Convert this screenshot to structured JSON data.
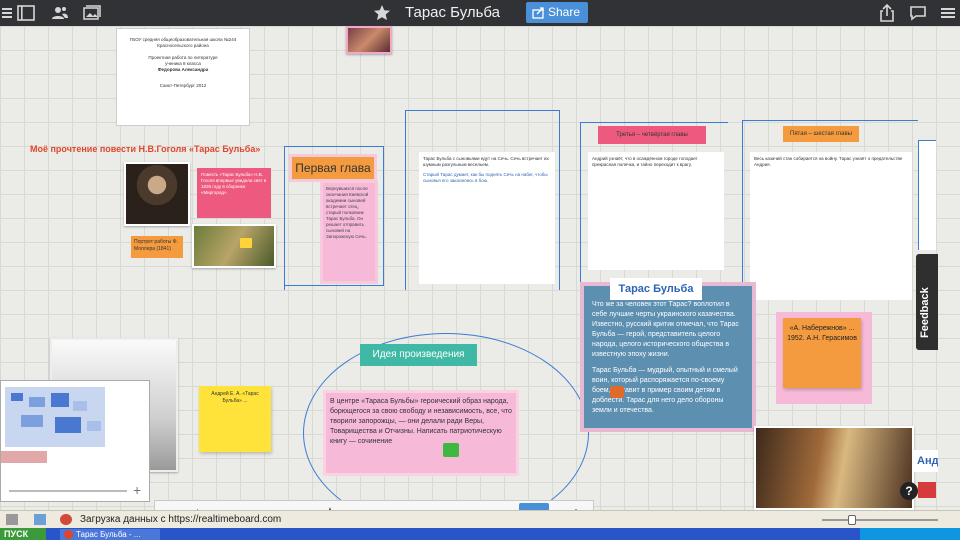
{
  "app": {
    "title": "Тарас Бульба",
    "share_label": "Share"
  },
  "board": {
    "intro_page": {
      "line1": "ГБОУ средняя общеобразовательная школа №244",
      "line2": "Красносельского района",
      "line3": "Проектная работа по литературе",
      "line4": "ученика 8 класса",
      "line5": "Федорова Александра",
      "line6": "Санкт-Петербург 2012"
    },
    "heading_reading": "Моё прочтение повести Н.В.Гоголя «Тарас Бульба»",
    "portrait_caption": "Портрет работы Ф. Моллера (1841)",
    "pink_note_top": "Повесть «Тарас Бульба» Н.В. Гоголя впервые увидела свет в 1835 году в сборнике «Миргород».",
    "first_chapter_title": "Первая глава",
    "first_chapter_text": "Вернувшихся после окончания Киевской академии сыновей встречает отец, старый полковник Тарас Бульба. Он решает отправить сыновей на Запорожскую Сечь.",
    "col2_text_black": "Тарас Бульба с сыновьями едут на Сечь. Сечь встречает их шумным разгульным весельем.",
    "col2_text_blue": "Старый Тарас думает, как бы поднять Сечь на набег, чтобы сыновья его закалились в бою.",
    "red_label_col3": "Третья – четвёртая главы",
    "col3_text": "Андрий узнаёт, что в осаждённом городе голодает прекрасная полячка, и тайно переходит к врагу.",
    "orange_label_col4": "Пятая – шестая главы",
    "col4_text": "Весь казачий стан собирается на войну. Тарас узнаёт о предательстве Андрия.",
    "cyan_idea_title": "Идея произведения",
    "idea_text": "В центре «Тараса Бульбы» героический образ народа, борющегося за свою свободу и независимость, все, что творили запорожцы, — они делали ради Веры, Товарищества и Отчизны. Написать патриотическую книгу — сочинение",
    "yellow_note_left": "Андрей Е. А. «Тарас Бульба» ...",
    "taras_title": "Тарас Бульба",
    "taras_text_1": "Что же за человек этот Тарас? воплотил в себе лучшие черты украинского казачества. Известно, русский критик отмечал, что Тарас Бульба — герой, представитель целого народа, целого исторического общества в известную эпоху жизни.",
    "taras_text_2": "Тарас Бульба — мудрый, опытный и смелый воин, который распоряжается по-своему боем, и ставит в пример своим детям в доблести. Тарас для него дело обороны земли и отечества.",
    "orange_note_right": "«А. Набережнов» ... 1952. А.Н. Герасимов",
    "side_label": "Анд",
    "feedback_label": "Feedback"
  },
  "toolbar": {
    "zoom_plus": "+",
    "tools": [
      "hand-tool",
      "select-tool",
      "pen-tool",
      "eraser-tool",
      "shape-tool",
      "text-tool",
      "note-tool",
      "comment-tool",
      "user-tool",
      "undo",
      "redo",
      "add",
      "clean"
    ]
  },
  "status": {
    "text": "Загрузка данных с https://realtimeboard.com"
  },
  "taskbar": {
    "start_label": "ПУСК",
    "window_label": "Тарас Бульба - ..."
  },
  "colors": {
    "accent_blue": "#4a90d9",
    "pink_note": "#ee5a7f",
    "cyan_label": "#3fb8a5",
    "orange_label": "#f59b3f",
    "yellow_note": "#ffe23a"
  }
}
